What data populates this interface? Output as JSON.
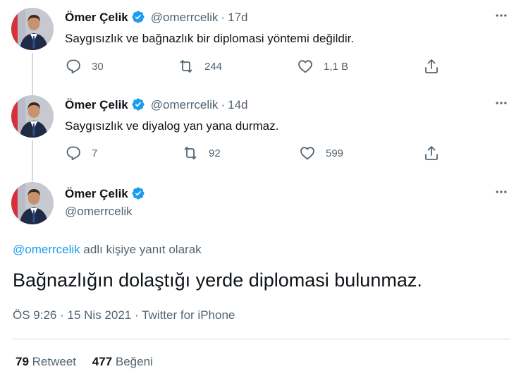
{
  "tweets": [
    {
      "name": "Ömer Çelik",
      "handle": "@omerrcelik",
      "time": "17d",
      "text": "Saygısızlık ve bağnazlık bir diplomasi yöntemi değildir.",
      "replies": "30",
      "retweets": "244",
      "likes": "1,1 B"
    },
    {
      "name": "Ömer Çelik",
      "handle": "@omerrcelik",
      "time": "14d",
      "text": "Saygısızlık ve diyalog yan yana durmaz.",
      "replies": "7",
      "retweets": "92",
      "likes": "599"
    }
  ],
  "main": {
    "name": "Ömer Çelik",
    "handle": "@omerrcelik",
    "reply_to_mention": "@omerrcelik",
    "reply_to_suffix": "adlı kişiye yanıt olarak",
    "text": "Bağnazlığın dolaştığı yerde diplomasi bulunmaz.",
    "time": "ÖS 9:26",
    "date": "15 Nis 2021",
    "source": "Twitter for iPhone",
    "retweet_count": "79",
    "retweet_label": "Retweet",
    "like_count": "477",
    "like_label": "Beğeni"
  },
  "icons": {
    "verified": "verified-badge-icon",
    "more": "more-icon",
    "reply": "reply-icon",
    "retweet": "retweet-icon",
    "like": "like-icon",
    "share": "share-icon"
  },
  "colors": {
    "accent": "#1d9bf0",
    "text": "#0f1419",
    "muted": "#536471",
    "border": "#cfd9de"
  }
}
